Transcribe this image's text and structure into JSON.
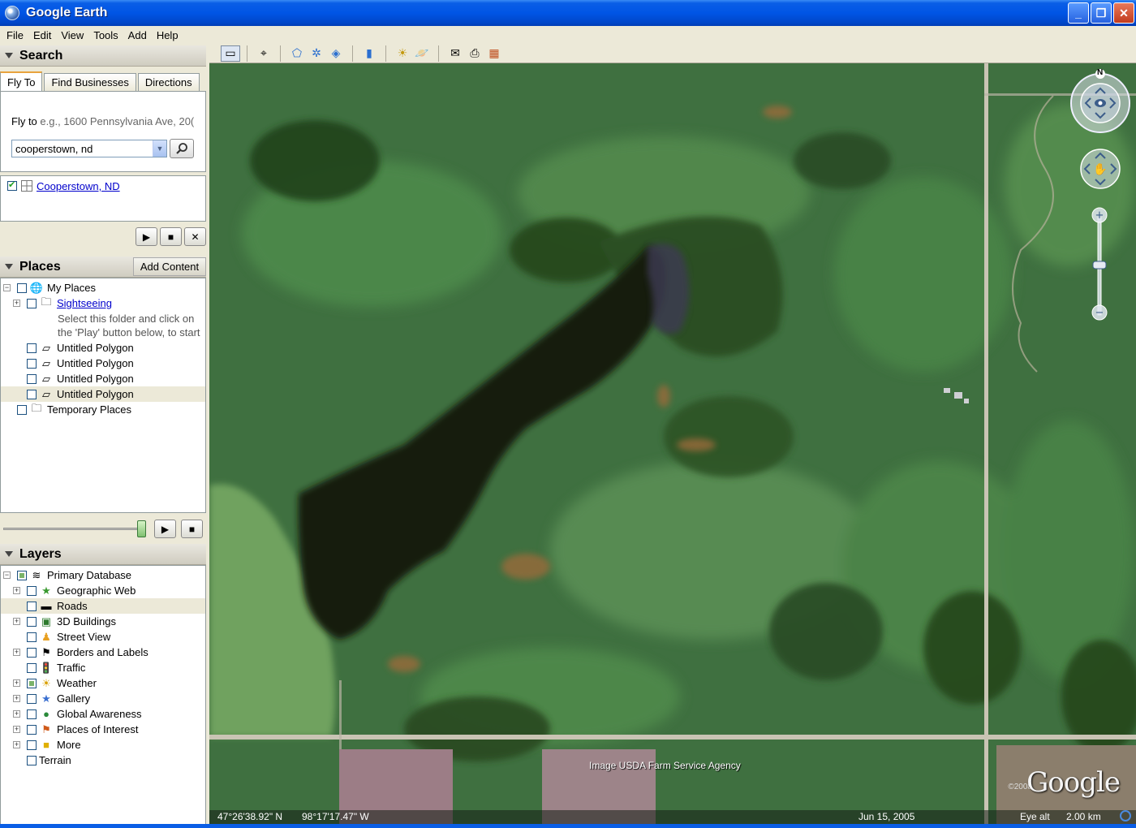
{
  "window": {
    "title": "Google Earth"
  },
  "menu": [
    "File",
    "Edit",
    "View",
    "Tools",
    "Add",
    "Help"
  ],
  "search": {
    "header": "Search",
    "tabs": [
      "Fly To",
      "Find Businesses",
      "Directions"
    ],
    "fly_to_label": "Fly to",
    "fly_to_placeholder": "e.g., 1600 Pennsylvania Ave, 20(",
    "query": "cooperstown, nd",
    "result": "Cooperstown, ND"
  },
  "places": {
    "header": "Places",
    "add_content": "Add Content",
    "items": {
      "my_places": "My Places",
      "sightseeing": "Sightseeing",
      "sightseeing_desc_1": "Select this folder and click on",
      "sightseeing_desc_2": "the 'Play' button below, to start",
      "poly1": "Untitled Polygon",
      "poly2": "Untitled Polygon",
      "poly3": "Untitled Polygon",
      "poly4": "Untitled Polygon",
      "temporary": "Temporary Places"
    }
  },
  "layers": {
    "header": "Layers",
    "items": {
      "primary": "Primary Database",
      "geoweb": "Geographic Web",
      "roads": "Roads",
      "buildings": "3D Buildings",
      "streetview": "Street View",
      "borders": "Borders and Labels",
      "traffic": "Traffic",
      "weather": "Weather",
      "gallery": "Gallery",
      "global": "Global Awareness",
      "poi": "Places of Interest",
      "more": "More",
      "terrain": "Terrain"
    }
  },
  "map": {
    "credit": "Image USDA Farm Service Agency",
    "logo": "Google",
    "copyright": "©2008",
    "compass_north": "N",
    "lat": "47°26'38.92\" N",
    "lon": "98°17'17.47\" W",
    "date": "Jun 15, 2005",
    "eye_alt_label": "Eye alt",
    "eye_alt_value": "2.00 km"
  },
  "colors": {
    "titlebar": "#0055e5",
    "link": "#0000cc",
    "terrain_green": "#3e6e3b",
    "water": "#16200f"
  }
}
